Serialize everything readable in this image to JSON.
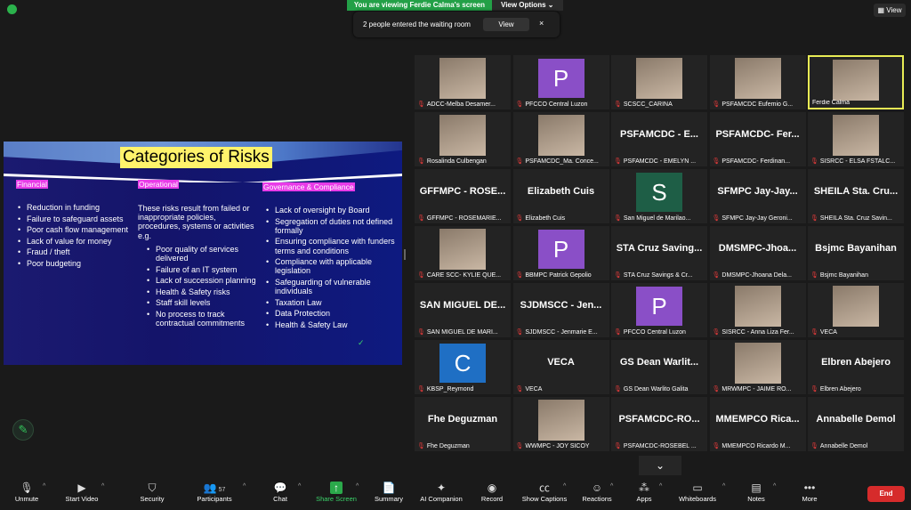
{
  "topbar": {
    "viewing": "You are viewing Ferdie Calma's screen",
    "view_options": "View Options",
    "view": "View"
  },
  "notification": {
    "text": "2 people entered the waiting room",
    "button": "View",
    "close": "×"
  },
  "slide": {
    "title": "Categories of Risks",
    "categories": [
      {
        "label": "Financial",
        "intro": "",
        "items": [
          "Reduction in funding",
          "Failure to safeguard assets",
          "Poor cash flow management",
          "Lack of value for money",
          "Fraud / theft",
          "Poor budgeting"
        ]
      },
      {
        "label": "Operational",
        "intro": "These risks result from failed or inappropriate policies, procedures, systems or activities e.g.",
        "items": [
          "Poor quality of services delivered",
          "Failure of an IT system",
          "Lack of succession planning",
          "Health & Safety risks",
          "Staff skill levels",
          "No process to track contractual commitments"
        ]
      },
      {
        "label": "Governance & Compliance",
        "intro": "",
        "items": [
          "Lack of oversight by Board",
          "Segregation of duties not defined formally",
          "Ensuring compliance with funders terms and conditions",
          "Compliance with applicable legislation",
          "Safeguarding of vulnerable individuals",
          "Taxation Law",
          "Data Protection",
          "Health & Safety Law"
        ]
      }
    ],
    "checkmark": "✓"
  },
  "participants": [
    {
      "name": "ADCC-Melba Desamer...",
      "type": "photo"
    },
    {
      "name": "PFCCO Central Luzon",
      "type": "avatar",
      "letter": "P",
      "color": "#8a4fc7"
    },
    {
      "name": "SCSCC_CARINA",
      "type": "photo"
    },
    {
      "name": "PSFAMCDC Eufemio G...",
      "type": "photo"
    },
    {
      "name": "Ferdie Calma",
      "type": "photo",
      "active": true
    },
    {
      "name": "Rosalinda Culbengan",
      "type": "photo"
    },
    {
      "name": "PSFAMCDC_Ma. Conce...",
      "type": "photo"
    },
    {
      "name": "PSFAMCDC - EMELYN ...",
      "type": "text",
      "big": "PSFAMCDC - E..."
    },
    {
      "name": "PSFAMCDC- Ferdinan...",
      "type": "text",
      "big": "PSFAMCDC- Fer..."
    },
    {
      "name": "SISRCC - ELSA FSTALC...",
      "type": "photo"
    },
    {
      "name": "GFFMPC - ROSEMARIE...",
      "type": "text",
      "big": "GFFMPC - ROSE..."
    },
    {
      "name": "Elizabeth Cuis",
      "type": "text",
      "big": "Elizabeth Cuis"
    },
    {
      "name": "San Miguel de Marilao...",
      "type": "avatar",
      "letter": "S",
      "color": "#1e5e46"
    },
    {
      "name": "SFMPC Jay-Jay Geroni...",
      "type": "text",
      "big": "SFMPC Jay-Jay..."
    },
    {
      "name": "SHEILA Sta. Cruz Savin...",
      "type": "text",
      "big": "SHEILA Sta. Cru..."
    },
    {
      "name": "CARE SCC- KYLIE QUE...",
      "type": "photo"
    },
    {
      "name": "BBMPC Patrick Gepolio",
      "type": "avatar",
      "letter": "P",
      "color": "#8a4fc7"
    },
    {
      "name": "STA Cruz Savings & Cr...",
      "type": "text",
      "big": "STA Cruz Saving..."
    },
    {
      "name": "DMSMPC-Jhoana Dela...",
      "type": "text",
      "big": "DMSMPC-Jhoa..."
    },
    {
      "name": "Bsjmc Bayanihan",
      "type": "text",
      "big": "Bsjmc Bayanihan"
    },
    {
      "name": "SAN MIGUEL DE MARI...",
      "type": "text",
      "big": "SAN MIGUEL DE..."
    },
    {
      "name": "SJDMSCC - Jenmarie E...",
      "type": "text",
      "big": "SJDMSCC - Jen..."
    },
    {
      "name": "PFCCO Central Luzon",
      "type": "avatar",
      "letter": "P",
      "color": "#8a4fc7"
    },
    {
      "name": "SISRCC - Anna Liza Fer...",
      "type": "photo"
    },
    {
      "name": "VECA",
      "type": "photo"
    },
    {
      "name": "KBSP_Reymond",
      "type": "avatar",
      "letter": "C",
      "color": "#1f6fc4"
    },
    {
      "name": "VECA",
      "type": "text",
      "big": "VECA"
    },
    {
      "name": "GS Dean Warlito Galita",
      "type": "text",
      "big": "GS Dean Warlit..."
    },
    {
      "name": "MRWMPC - JAIME RO...",
      "type": "photo"
    },
    {
      "name": "Elbren Abejero",
      "type": "text",
      "big": "Elbren Abejero"
    },
    {
      "name": "Fhe Deguzman",
      "type": "text",
      "big": "Fhe Deguzman"
    },
    {
      "name": "WWMPC - JOY SICOY",
      "type": "photo"
    },
    {
      "name": "PSFAMCDC-ROSEBEL ...",
      "type": "text",
      "big": "PSFAMCDC-RO..."
    },
    {
      "name": "MMEMPCO Ricardo M...",
      "type": "text",
      "big": "MMEMPCO Rica..."
    },
    {
      "name": "Annabelle Demol",
      "type": "text",
      "big": "Annabelle Demol"
    }
  ],
  "toolbar": {
    "unmute": "Unmute",
    "start_video": "Start Video",
    "security": "Security",
    "participants": "Participants",
    "participants_count": "57",
    "chat": "Chat",
    "share_screen": "Share Screen",
    "summary": "Summary",
    "ai_companion": "AI Companion",
    "record": "Record",
    "show_captions": "Show Captions",
    "reactions": "Reactions",
    "apps": "Apps",
    "whiteboards": "Whiteboards",
    "notes": "Notes",
    "more": "More",
    "end": "End"
  }
}
